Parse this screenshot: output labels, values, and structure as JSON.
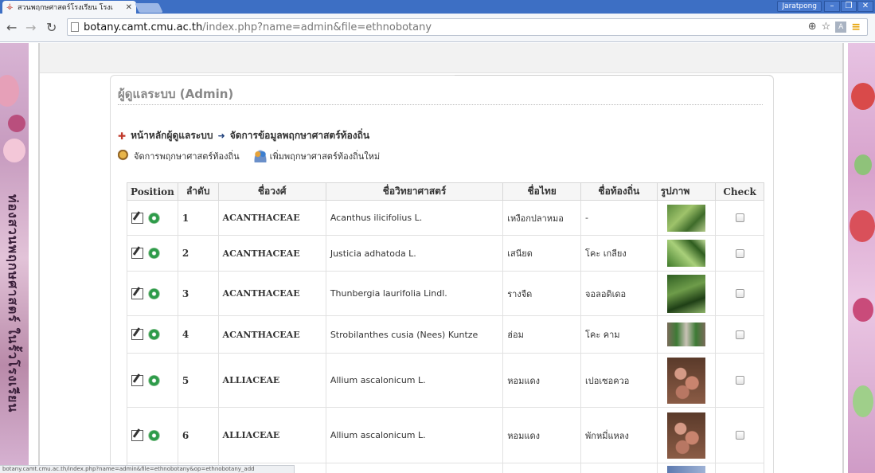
{
  "browser": {
    "tab_title": "สวนพฤกษศาสตร์โรงเรียน โรงเ",
    "user": "Jaratpong",
    "url_host": "botany.camt.cmu.ac.th",
    "url_path": "/index.php?name=admin&file=ethnobotany",
    "status_url": "botany.camt.cmu.ac.th/index.php?name=admin&file=ethnobotany&op=ethnobotany_add"
  },
  "side_banner_text": "ท่องสวนพฤกษศาสตร์ ในรั้วโรงเรียน",
  "panel": {
    "title": "ผู้ดูแลระบบ (Admin)",
    "breadcrumb": {
      "home": "หน้าหลักผู้ดูแลระบบ",
      "current": "จัดการข้อมูลพฤกษาศาสตร์ท้องถิ่น"
    },
    "actions": {
      "manage": "จัดการพฤกษาศาสตร์ท้องถิ่น",
      "add": "เพิ่มพฤกษาศาสตร์ท้องถิ่นใหม่"
    }
  },
  "table": {
    "headers": [
      "Position",
      "ลำดับ",
      "ชื่อวงศ์",
      "ชื่อวิทยาศาสตร์",
      "ชื่อไทย",
      "ชื่อท้องถิ่น",
      "รูปภาพ",
      "Check"
    ],
    "rows": [
      {
        "no": "1",
        "family": "ACANTHACEAE",
        "sci": "Acanthus ilicifolius L.",
        "thai": "เหงือกปลาหมอ",
        "local": "-"
      },
      {
        "no": "2",
        "family": "ACANTHACEAE",
        "sci": "Justicia adhatoda L.",
        "thai": "เสนียด",
        "local": "โคะ เกลียง"
      },
      {
        "no": "3",
        "family": "ACANTHACEAE",
        "sci": "Thunbergia laurifolia Lindl.",
        "thai": "รางจืด",
        "local": "จอลอดิเดอ"
      },
      {
        "no": "4",
        "family": "ACANTHACEAE",
        "sci": "Strobilanthes cusia (Nees) Kuntze",
        "thai": "ฮ่อม",
        "local": "โคะ คาม"
      },
      {
        "no": "5",
        "family": "ALLIACEAE",
        "sci": "Allium ascalonicum L.",
        "thai": "หอมแดง",
        "local": "เปอเซอควอ"
      },
      {
        "no": "6",
        "family": "ALLIACEAE",
        "sci": "Allium ascalonicum L.",
        "thai": "หอมแดง",
        "local": "พักหมี่แหลง"
      }
    ]
  }
}
